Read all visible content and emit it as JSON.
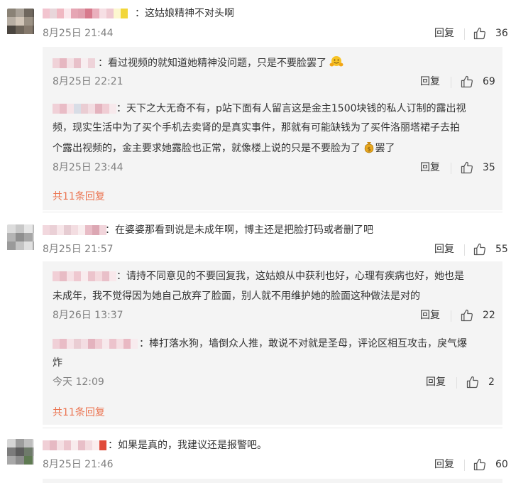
{
  "comments": [
    {
      "sep": "：",
      "text": "这姑娘精神不对头啊",
      "time": "8月25日 21:44",
      "reply_label": "回复",
      "likes": "36",
      "replies": [
        {
          "sep": "：",
          "text": "看过视频的就知道她精神没问题，只是不要脸罢了",
          "time": "8月25日 22:21",
          "reply_label": "回复",
          "likes": "69"
        },
        {
          "sep": "：",
          "text_lines": [
            "天下之大无奇不有，p站下面有人留言这是金主1500块钱的私人订制的露出视",
            "频，现实生活中为了买个手机去卖肾的是真实事件，那就有可能缺钱为了买件洛丽塔裙子去拍",
            "个露出视频的，金主要求她露脸也正常，就像楼上说的只是不要脸为了",
            "罢了"
          ],
          "time": "8月25日 23:44",
          "reply_label": "回复",
          "likes": "35"
        }
      ],
      "more": "共11条回复"
    },
    {
      "sep": "：",
      "text": "在婆婆那看到说是未成年啊，博主还是把脸打码或者删了吧",
      "time": "8月25日 21:57",
      "reply_label": "回复",
      "likes": "55",
      "replies": [
        {
          "sep": "：",
          "text_lines": [
            "请持不同意见的不要回复我，这姑娘从中获利也好，心理有疾病也好，她也是",
            "未成年，我不觉得因为她自己放弃了脸面，别人就不用维护她的脸面这种做法是对的"
          ],
          "time": "8月26日 13:37",
          "reply_label": "回复",
          "likes": "22"
        },
        {
          "sep": "：",
          "text_lines": [
            "棒打落水狗，墙倒众人推，敢说不对就是圣母，评论区相互攻击，戾气爆",
            "炸"
          ],
          "time": "今天 12:09",
          "reply_label": "回复",
          "likes": "2"
        }
      ],
      "more": "共11条回复"
    },
    {
      "sep": "：",
      "text": "如果是真的，我建议还是报警吧。",
      "time": "8月25日 21:46",
      "reply_label": "回复",
      "likes": "60",
      "replies": []
    }
  ],
  "colors": {
    "link": "#eb7350",
    "meta": "#808080",
    "reply_bg": "#f4f4f4"
  },
  "icons": {
    "like": "thumbs-up-icon",
    "emoji_1": "hugging-face-emoji",
    "emoji_2": "money-bag-emoji"
  }
}
